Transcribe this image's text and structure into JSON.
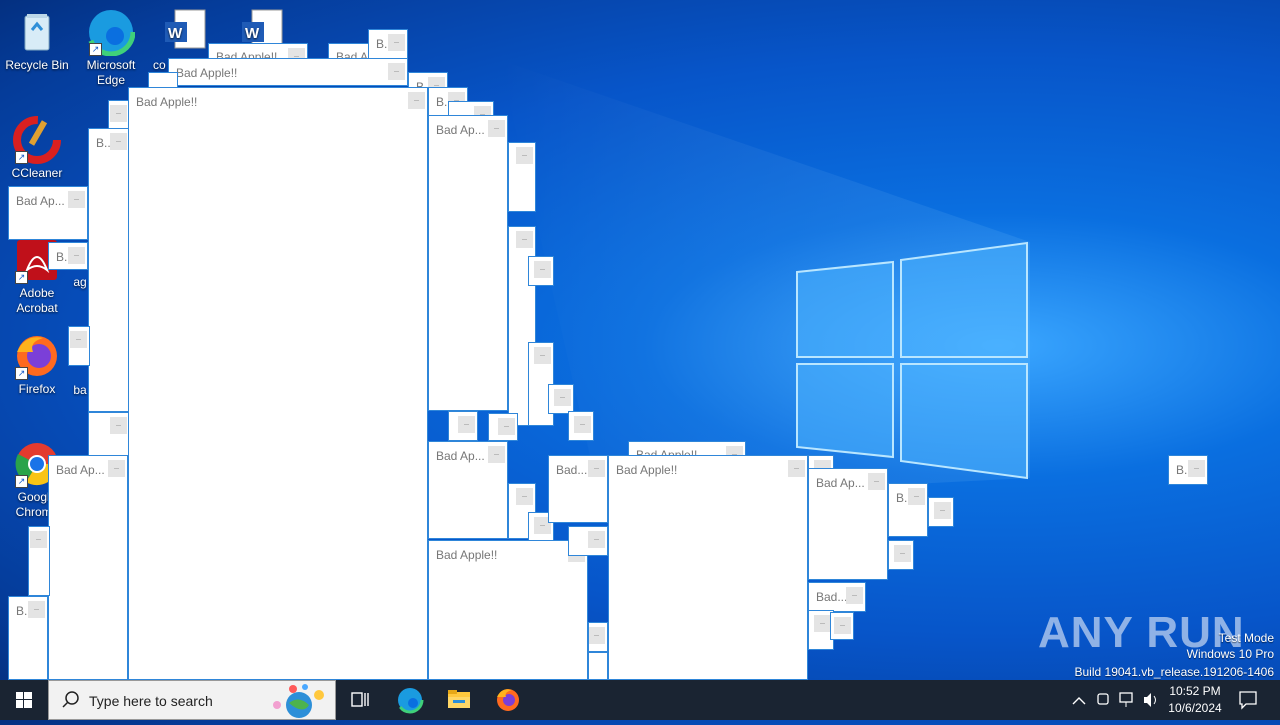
{
  "desktop": {
    "icons": [
      {
        "label": "Recycle Bin"
      },
      {
        "label": "Microsoft Edge"
      },
      {
        "label": "co"
      },
      {
        "label": "CCleaner"
      },
      {
        "label": "Adobe Acrobat"
      },
      {
        "label": "ag"
      },
      {
        "label": "Firefox"
      },
      {
        "label": "ba"
      },
      {
        "label": "Google Chrome"
      }
    ]
  },
  "windows": {
    "title_full": "Bad Apple!!",
    "title_short": "Bad Ap...",
    "title_shorter": "Bad...",
    "title_min": "B..",
    "title_b": "B",
    "title_bad_a": "Bad A..."
  },
  "watermark": {
    "brand": "ANY RUN",
    "test_mode": "Test Mode",
    "edition": "Windows 10 Pro",
    "build": "Build 19041.vb_release.191206-1406"
  },
  "taskbar": {
    "search_placeholder": "Type here to search",
    "time": "10:52 PM",
    "date": "10/6/2024"
  }
}
